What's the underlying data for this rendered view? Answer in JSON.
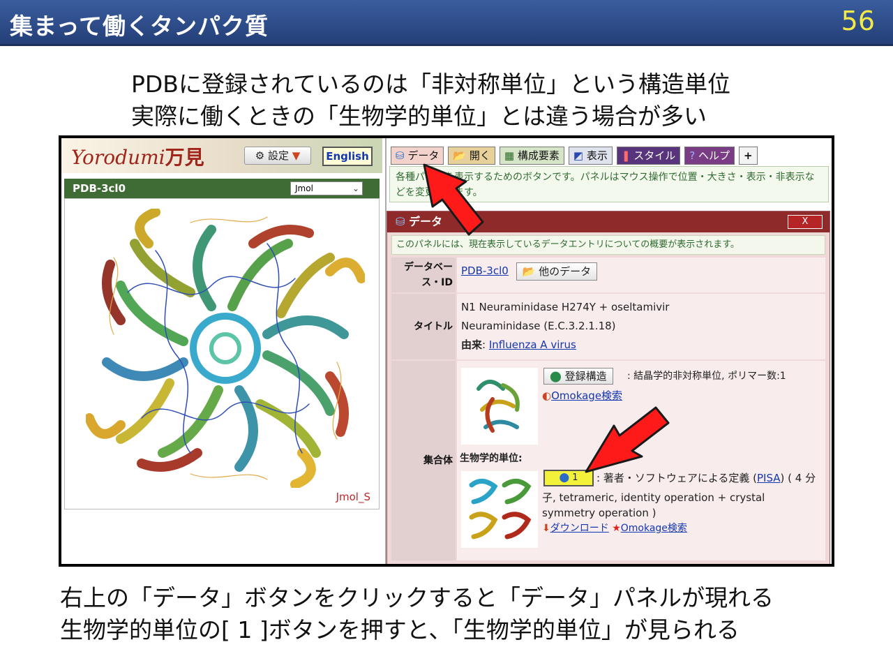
{
  "slide": {
    "title": "集まって働くタンパク質",
    "page_number": "56",
    "lead_line1": "PDBに登録されているのは「非対称単位」という構造単位",
    "lead_line2": "実際に働くときの「生物学的単位」とは違う場合が多い",
    "foot_line1": "右上の「データ」ボタンをクリックすると「データ」パネルが現れる",
    "foot_line2": "生物学的単位の[ 1 ]ボタンを押すと、「生物学的単位」が見られる"
  },
  "app": {
    "logo_text": "Yorodumi",
    "logo_kanji": "万見",
    "settings_label": "設定",
    "english_label": "English",
    "viewer_title": "PDB-3cl0",
    "viewer_engine": "Jmol",
    "viewer_mode_label": "Jmol_S"
  },
  "toolbar": {
    "data": "データ",
    "open": "開く",
    "components": "構成要素",
    "display": "表示",
    "style": "スタイル",
    "help": "ヘルプ",
    "plus": "+"
  },
  "hint": {
    "text": "各種パネルを表示するためのボタンです。パネルはマウス操作で位置・大きさ・表示・非表示などを変更できます。"
  },
  "data_panel": {
    "title": "データ",
    "close": "X",
    "note": "このパネルには、現在表示しているデータエントリについての概要が表示されます。",
    "db_id_label": "データベース・ID",
    "db_id_value": "PDB-3cl0",
    "other_data": "他のデータ",
    "title_label": "タイトル",
    "title_line1": "N1 Neuraminidase H274Y + oseltamivir",
    "title_line2": "Neuraminidase (E.C.3.2.1.18)",
    "origin_label": "由来",
    "origin_value": "Influenza A virus",
    "assembly_label": "集合体",
    "registered_structure": "登録構造",
    "registered_desc": ": 結晶学的非対称単位, ポリマー数:1",
    "omokage_search": "Omokage検索",
    "bio_unit_label": "生物学的単位:",
    "bio_unit_button": "1",
    "bio_desc_1": ": 著者・ソフトウェアによる定義 (",
    "pisa": "PISA",
    "bio_desc_2": ") ( 4 分",
    "bio_desc_3": "子, tetrameric, identity operation + crystal",
    "bio_desc_4": "symmetry operation )",
    "download": "ダウンロード",
    "omokage_search_2": "Omokage検索"
  },
  "colors": {
    "title_bar": "#2c4a88",
    "page_number": "#f4e94a",
    "panel_header": "#8f2a2a",
    "arrow": "#ff1a1a",
    "link": "#1337b0"
  }
}
